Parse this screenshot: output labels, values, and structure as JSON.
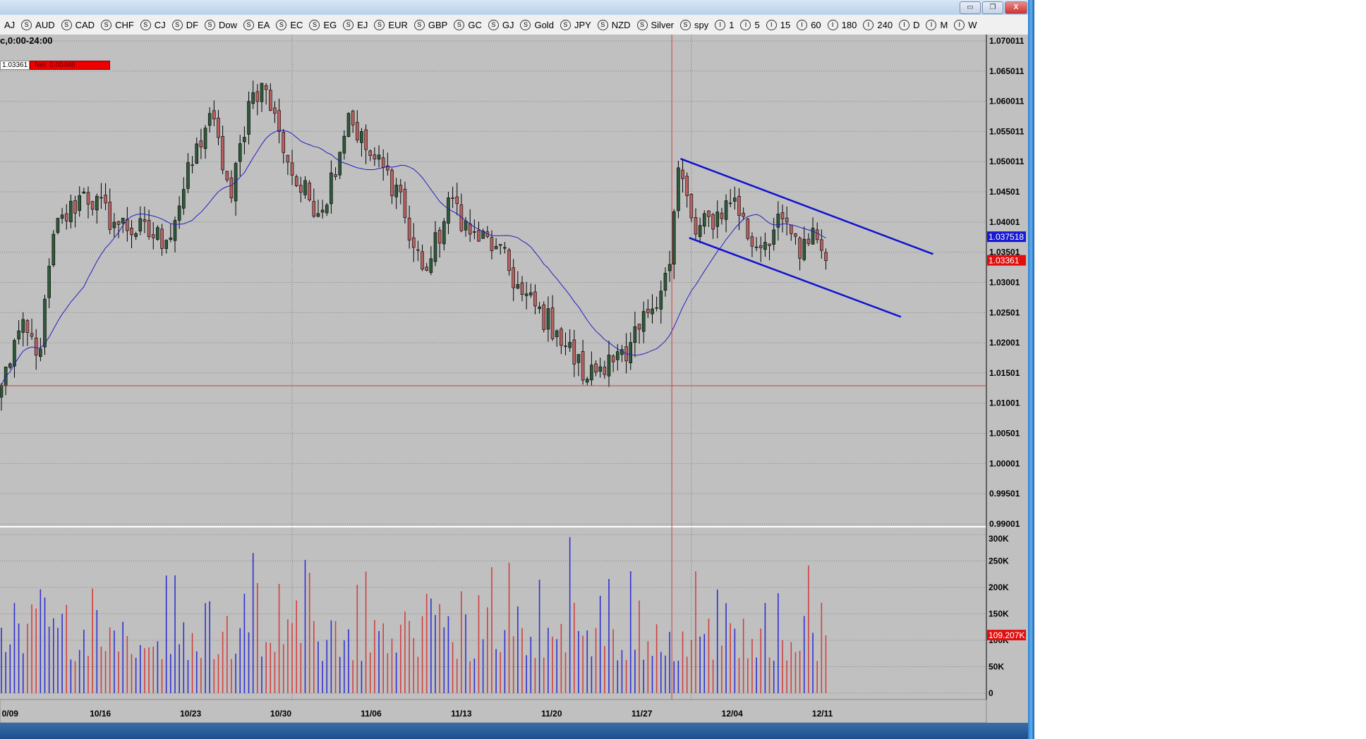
{
  "toolbar": {
    "items": [
      {
        "icon": "",
        "label": "AJ"
      },
      {
        "icon": "S",
        "label": "AUD"
      },
      {
        "icon": "S",
        "label": "CAD"
      },
      {
        "icon": "S",
        "label": "CHF"
      },
      {
        "icon": "S",
        "label": "CJ"
      },
      {
        "icon": "S",
        "label": "DF"
      },
      {
        "icon": "S",
        "label": "Dow"
      },
      {
        "icon": "S",
        "label": "EA"
      },
      {
        "icon": "S",
        "label": "EC"
      },
      {
        "icon": "S",
        "label": "EG"
      },
      {
        "icon": "S",
        "label": "EJ"
      },
      {
        "icon": "S",
        "label": "EUR"
      },
      {
        "icon": "S",
        "label": "GBP"
      },
      {
        "icon": "S",
        "label": "GC"
      },
      {
        "icon": "S",
        "label": "GJ"
      },
      {
        "icon": "S",
        "label": "Gold"
      },
      {
        "icon": "S",
        "label": "JPY"
      },
      {
        "icon": "S",
        "label": "NZD"
      },
      {
        "icon": "S",
        "label": "Silver"
      },
      {
        "icon": "S",
        "label": "spy"
      },
      {
        "icon": "I",
        "label": "1"
      },
      {
        "icon": "I",
        "label": "5"
      },
      {
        "icon": "I",
        "label": "15"
      },
      {
        "icon": "I",
        "label": "60"
      },
      {
        "icon": "I",
        "label": "180"
      },
      {
        "icon": "I",
        "label": "240"
      },
      {
        "icon": "I",
        "label": "D"
      },
      {
        "icon": "I",
        "label": "M"
      },
      {
        "icon": "I",
        "label": "W"
      }
    ]
  },
  "header": {
    "session": "c,0:00-24:00",
    "last_value": "1.03361",
    "net_label": "Net",
    "net_value": "0.00468"
  },
  "window_buttons": {
    "minimize": "▭",
    "restore": "❐",
    "close": "X"
  },
  "colors": {
    "up": "#2f5a3a",
    "down": "#b86060",
    "ma": "#2020c0",
    "trend": "#1010d0",
    "crosshair": "#d04040",
    "vol_up": "#3030d0",
    "vol_down": "#d04040",
    "bg": "#c0c0c0"
  },
  "chart_data": {
    "type": "candlestick",
    "bars": 191,
    "close_anchors": [
      [
        0,
        1.013
      ],
      [
        4,
        1.022
      ],
      [
        9,
        1.019
      ],
      [
        12,
        1.038
      ],
      [
        19,
        1.045
      ],
      [
        26,
        1.04
      ],
      [
        38,
        1.037
      ],
      [
        48,
        1.058
      ],
      [
        53,
        1.044
      ],
      [
        57,
        1.06
      ],
      [
        60,
        1.063
      ],
      [
        64,
        1.055
      ],
      [
        68,
        1.046
      ],
      [
        74,
        1.042
      ],
      [
        80,
        1.058
      ],
      [
        84,
        1.052
      ],
      [
        92,
        1.045
      ],
      [
        94,
        1.037
      ],
      [
        98,
        1.032
      ],
      [
        104,
        1.044
      ],
      [
        108,
        1.038
      ],
      [
        114,
        1.036
      ],
      [
        120,
        1.028
      ],
      [
        128,
        1.022
      ],
      [
        135,
        1.014
      ],
      [
        140,
        1.018
      ],
      [
        144,
        1.017
      ],
      [
        149,
        1.025
      ],
      [
        154,
        1.033
      ],
      [
        156,
        1.049
      ],
      [
        160,
        1.038
      ],
      [
        169,
        1.044
      ],
      [
        173,
        1.036
      ],
      [
        181,
        1.04
      ],
      [
        184,
        1.034
      ],
      [
        187,
        1.039
      ],
      [
        190,
        1.03361
      ]
    ],
    "ma_period": 20,
    "price_ticks": [
      "1.070011",
      "1.065011",
      "1.060011",
      "1.055011",
      "1.050011",
      "1.04501",
      "1.04001",
      "1.03501",
      "1.03001",
      "1.02501",
      "1.02001",
      "1.01501",
      "1.01001",
      "1.00501",
      "1.00001",
      "0.99501",
      "0.99001"
    ],
    "price_range": [
      0.99001,
      1.070011
    ],
    "ma_last": "1.037518",
    "last_price": "1.03361",
    "volume_ticks": [
      "300K",
      "250K",
      "200K",
      "150K",
      "100K",
      "50K",
      "0"
    ],
    "volume_range": [
      0,
      300
    ],
    "volume_last": "109.207K",
    "x_labels": [
      "0/09",
      "10/16",
      "10/23",
      "10/30",
      "11/06",
      "11/13",
      "11/20",
      "11/27",
      "12/04",
      "12/11"
    ],
    "x_label_first_bar": 2,
    "bars_per_week": 20.8,
    "trendlines": [
      {
        "name": "upper",
        "from": [
          156.5,
          1.0505
        ],
        "to": [
          214.7,
          1.0347
        ]
      },
      {
        "name": "lower",
        "from": [
          158.5,
          1.0374
        ],
        "to": [
          207.3,
          1.0243
        ]
      }
    ],
    "crosshair": {
      "bar": 154.5,
      "price": 1.0129
    },
    "separators_bars": [
      67,
      159
    ]
  }
}
